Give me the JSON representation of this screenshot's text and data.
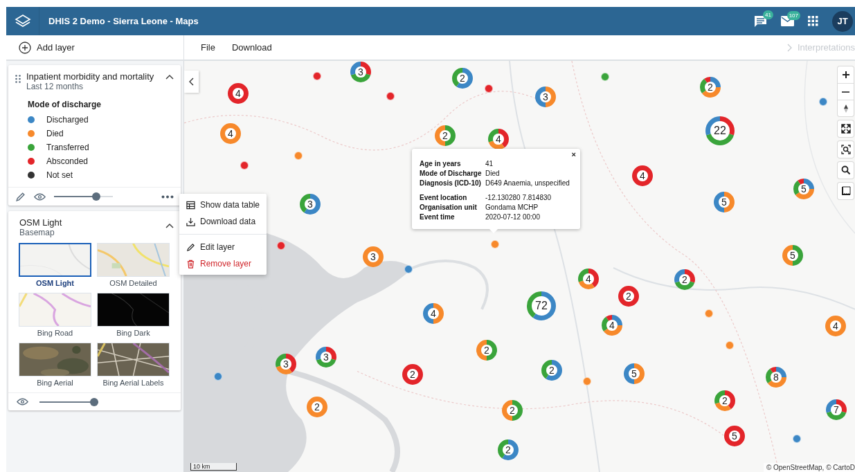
{
  "header": {
    "title": "DHIS 2 Demo - Sierra Leone - Maps",
    "messages_badge": "41",
    "mail_badge": "107",
    "avatar": "JT"
  },
  "toolbar": {
    "add_layer": "Add layer",
    "menus": [
      "File",
      "Download"
    ],
    "interpretations": {
      "label": "Interpretations",
      "disabled": true
    }
  },
  "layers": [
    {
      "title": "Inpatient morbidity and mortality",
      "subtitle": "Last 12 months",
      "expanded": true,
      "legend_title": "Mode of discharge",
      "legend": [
        {
          "label": "Discharged",
          "color": "#3c87c5"
        },
        {
          "label": "Died",
          "color": "#f7892b"
        },
        {
          "label": "Transferred",
          "color": "#3aa43b"
        },
        {
          "label": "Absconded",
          "color": "#e3252a"
        },
        {
          "label": "Not set",
          "color": "#333333"
        }
      ],
      "opacity": {
        "level": 0.75
      }
    }
  ],
  "layer_menu": {
    "sections": [
      [
        {
          "label": "Show data table",
          "kind": "table",
          "danger": false
        },
        {
          "label": "Download data",
          "kind": "download",
          "danger": false
        }
      ],
      [
        {
          "label": "Edit layer",
          "kind": "edit",
          "danger": false
        },
        {
          "label": "Remove layer",
          "kind": "delete",
          "danger": true
        }
      ]
    ]
  },
  "basemap": {
    "title": "OSM Light",
    "subtitle": "Basemap",
    "expanded": true,
    "options": [
      {
        "label": "OSM Light",
        "selected": true,
        "kind": "light"
      },
      {
        "label": "OSM Detailed",
        "selected": false,
        "kind": "detailed"
      },
      {
        "label": "Bing Road",
        "selected": false,
        "kind": "road"
      },
      {
        "label": "Bing Dark",
        "selected": false,
        "kind": "dark"
      },
      {
        "label": "Bing Aerial",
        "selected": false,
        "kind": "aerial"
      },
      {
        "label": "Bing Aerial Labels",
        "selected": false,
        "kind": "aerial_labels"
      }
    ],
    "opacity": {
      "level": 1
    }
  },
  "map": {
    "clusters": [
      {
        "count": "3"
      },
      {
        "count": "4"
      },
      {
        "count": "2"
      },
      {
        "count": "3"
      },
      {
        "count": "2"
      },
      {
        "count": "4"
      },
      {
        "count": "2"
      },
      {
        "count": "4"
      },
      {
        "count": "22"
      },
      {
        "count": "4"
      },
      {
        "count": "3"
      },
      {
        "count": "5"
      },
      {
        "count": "5"
      },
      {
        "count": "3"
      },
      {
        "count": "5"
      },
      {
        "count": "4"
      },
      {
        "count": "2"
      },
      {
        "count": "2"
      },
      {
        "count": "72"
      },
      {
        "count": "4"
      },
      {
        "count": "4"
      },
      {
        "count": "4"
      },
      {
        "count": "2"
      },
      {
        "count": "3"
      },
      {
        "count": "3"
      },
      {
        "count": "2"
      },
      {
        "count": "2"
      },
      {
        "count": "5"
      },
      {
        "count": "8"
      },
      {
        "count": "2"
      },
      {
        "count": "2"
      },
      {
        "count": "2"
      },
      {
        "count": "7"
      },
      {
        "count": "5"
      },
      {
        "count": "2"
      }
    ],
    "events": [
      {
        "color": "#e3252a"
      },
      {
        "color": "#e3252a"
      },
      {
        "color": "#e3252a"
      },
      {
        "color": "#e3252a"
      },
      {
        "color": "#e3252a"
      },
      {
        "color": "#3aa43b"
      },
      {
        "color": "#3c87c5"
      },
      {
        "color": "#3c87c5"
      },
      {
        "color": "#3c87c5"
      },
      {
        "color": "#3c87c5"
      },
      {
        "color": "#f7892b"
      },
      {
        "color": "#f7892b"
      },
      {
        "color": "#f7892b"
      },
      {
        "color": "#f7892b"
      },
      {
        "color": "#f7892b"
      }
    ],
    "popup": {
      "sections": [
        [
          {
            "label": "Age in years",
            "value": "41"
          },
          {
            "label": "Mode of Discharge",
            "value": "Died"
          },
          {
            "label": "Diagnosis (ICD-10)",
            "value": "D649 Anaemia, unspecified"
          }
        ],
        [
          {
            "label": "Event location",
            "value": "-12.130280 7.814830"
          },
          {
            "label": "Organisation unit",
            "value": "Gondama MCHP"
          },
          {
            "label": "Event time",
            "value": "2020-07-12 00:00"
          }
        ]
      ],
      "close": "×"
    },
    "scale": "10 km",
    "attribution": "© OpenStreetMap, © CartoD"
  }
}
